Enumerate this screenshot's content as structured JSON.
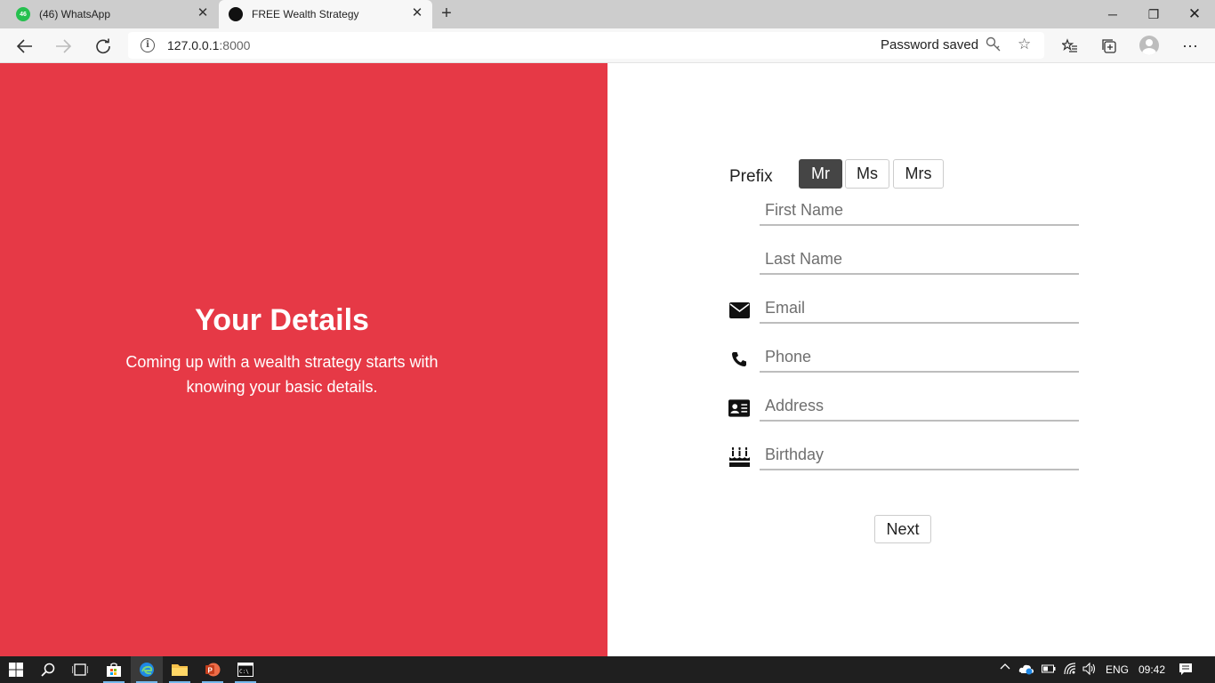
{
  "browser": {
    "tabs": [
      {
        "title": "(46) WhatsApp",
        "badge": "46",
        "active": false
      },
      {
        "title": "FREE Wealth Strategy",
        "active": true
      }
    ],
    "address": {
      "host": "127.0.0.1",
      "port": ":8000"
    },
    "password_saved": "Password saved",
    "icons": {
      "back": "back-arrow-icon",
      "forward": "forward-arrow-icon",
      "refresh": "refresh-icon",
      "info": "info-icon",
      "key": "key-icon",
      "favorite": "star-icon",
      "favorites": "favorites-list-icon",
      "collections": "collections-icon",
      "profile": "profile-avatar-icon",
      "menu": "more-menu-icon"
    }
  },
  "hero": {
    "title": "Your Details",
    "subtitle": "Coming up with a wealth strategy starts with knowing your basic details.",
    "background_color": "#e63946"
  },
  "form": {
    "prefix_label": "Prefix",
    "prefix_options": [
      "Mr",
      "Ms",
      "Mrs"
    ],
    "prefix_selected": "Mr",
    "fields": {
      "first_name": {
        "placeholder": "First Name",
        "value": ""
      },
      "last_name": {
        "placeholder": "Last Name",
        "value": ""
      },
      "email": {
        "placeholder": "Email",
        "value": "",
        "icon": "envelope-icon"
      },
      "phone": {
        "placeholder": "Phone",
        "value": "",
        "icon": "phone-icon"
      },
      "address": {
        "placeholder": "Address",
        "value": "",
        "icon": "address-card-icon"
      },
      "birthday": {
        "placeholder": "Birthday",
        "value": "",
        "icon": "birthday-cake-icon"
      }
    },
    "next_label": "Next"
  },
  "taskbar": {
    "language": "ENG",
    "time": "09:42",
    "apps": [
      "start-icon",
      "search-icon",
      "task-view-icon",
      "store-icon",
      "edge-icon",
      "file-explorer-icon",
      "powerpoint-icon",
      "terminal-icon"
    ]
  }
}
